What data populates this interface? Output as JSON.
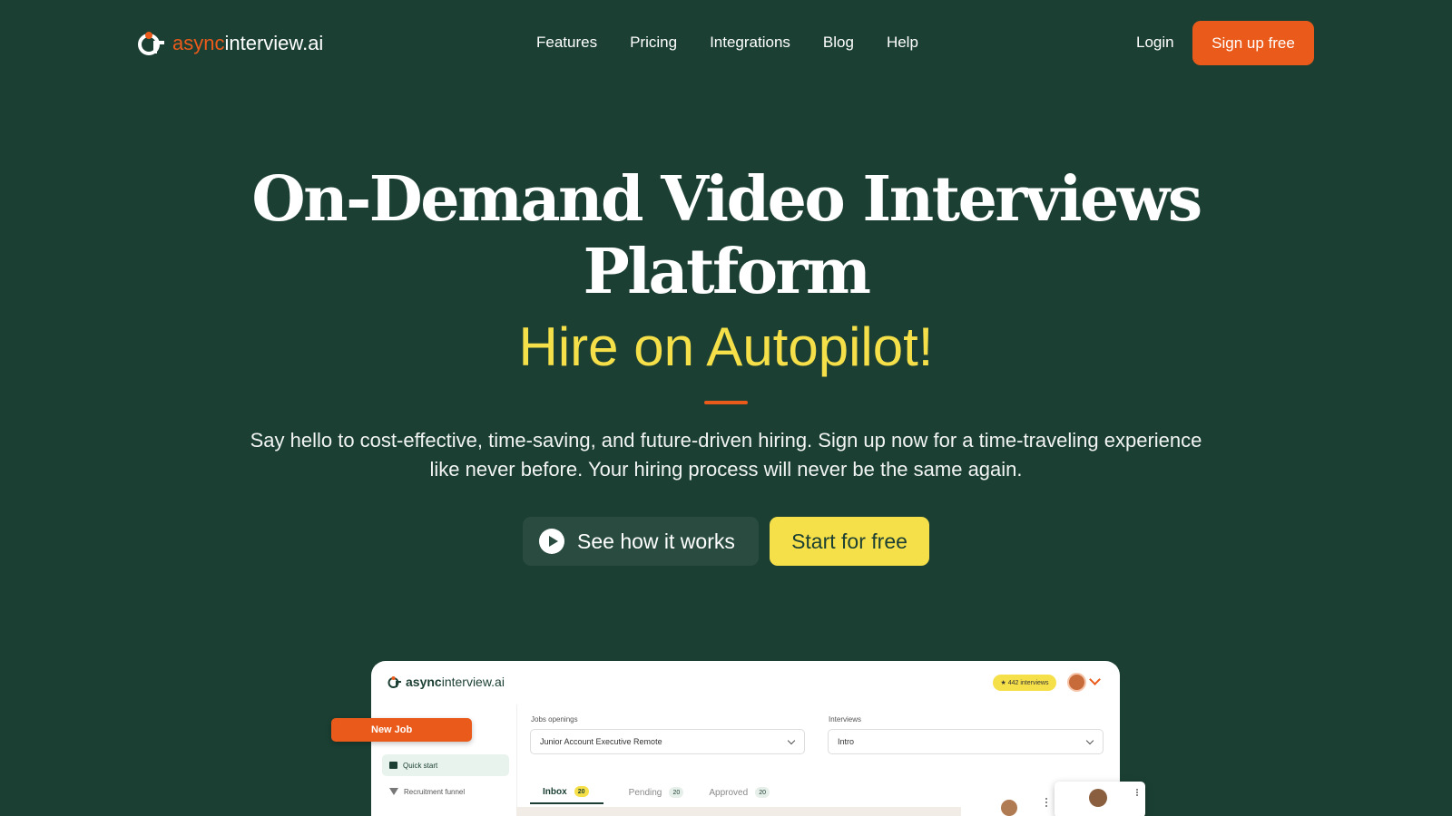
{
  "nav": {
    "logo_async": "async",
    "logo_rest": "interview.ai",
    "links": [
      "Features",
      "Pricing",
      "Integrations",
      "Blog",
      "Help"
    ],
    "login": "Login",
    "signup": "Sign up free"
  },
  "hero": {
    "title_line1": "On-Demand Video Interviews",
    "title_line2": "Platform",
    "subtitle": "Hire on Autopilot!",
    "description": "Say hello to cost-effective, time-saving, and future-driven hiring. Sign up now for a time-traveling experience like never before. Your hiring process will never be the same again.",
    "btn_how": "See how it works",
    "btn_start": "Start for free"
  },
  "dashboard": {
    "logo_async": "async",
    "logo_rest": "interview.ai",
    "badge": "★ 442 interviews",
    "new_job": "New Job",
    "quick_start": "Quick start",
    "recruitment_funnel": "Recruitment funnel",
    "jobs_label": "Jobs openings",
    "jobs_value": "Junior Account Executive Remote",
    "interviews_label": "Interviews",
    "interviews_value": "Intro",
    "tabs": [
      {
        "label": "Inbox",
        "count": "20"
      },
      {
        "label": "Pending",
        "count": "20"
      },
      {
        "label": "Approved",
        "count": "20"
      }
    ]
  },
  "colors": {
    "background": "#1b3f33",
    "accent_orange": "#ea5b1b",
    "accent_yellow": "#f6e04a"
  }
}
